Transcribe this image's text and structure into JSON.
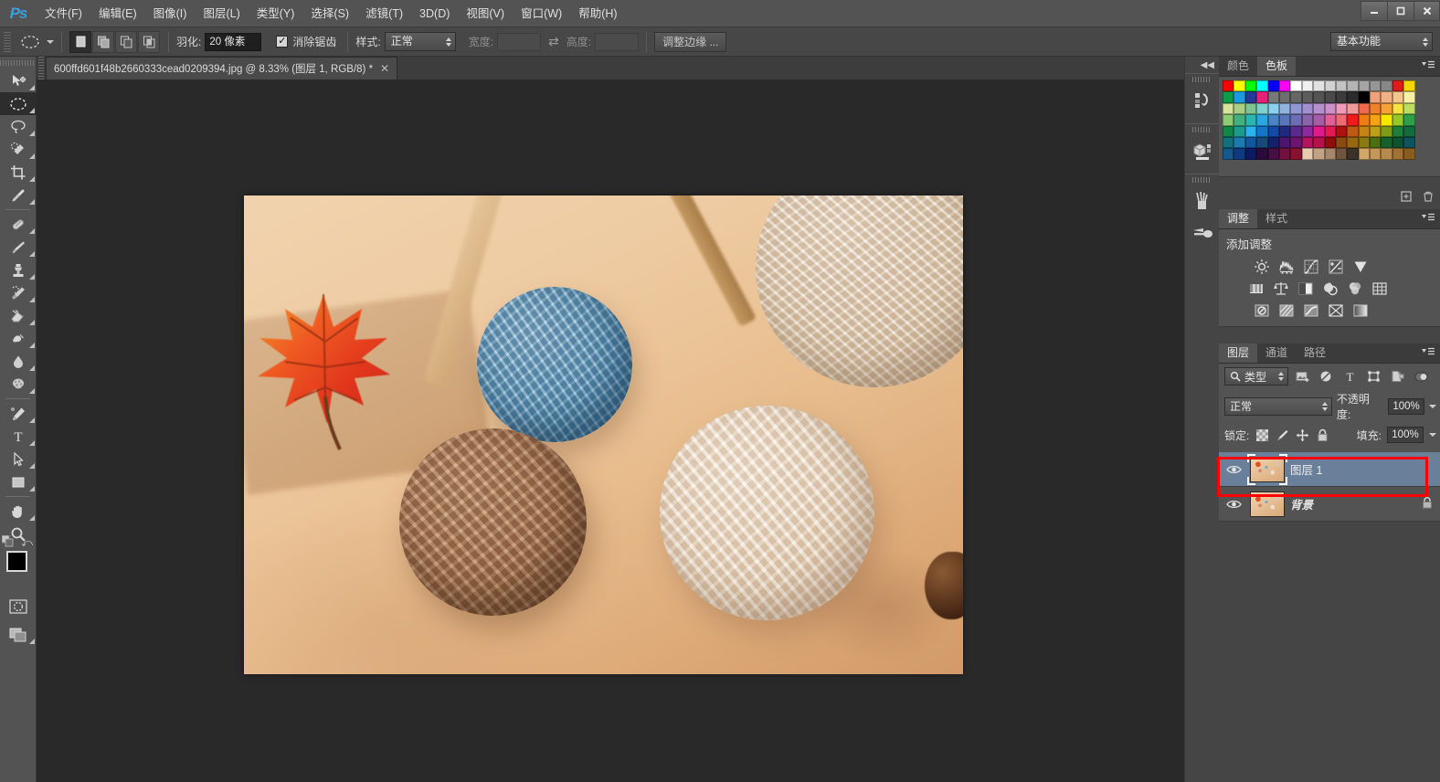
{
  "app": {
    "name": "Adobe Photoshop",
    "logo": "Ps"
  },
  "window_controls": {
    "minimize": "—",
    "restore": "❐",
    "close": "✕"
  },
  "menubar": {
    "items": [
      {
        "label": "文件(F)",
        "name": "menu-file"
      },
      {
        "label": "编辑(E)",
        "name": "menu-edit"
      },
      {
        "label": "图像(I)",
        "name": "menu-image"
      },
      {
        "label": "图层(L)",
        "name": "menu-layer"
      },
      {
        "label": "类型(Y)",
        "name": "menu-type"
      },
      {
        "label": "选择(S)",
        "name": "menu-select"
      },
      {
        "label": "滤镜(T)",
        "name": "menu-filter"
      },
      {
        "label": "3D(D)",
        "name": "menu-3d"
      },
      {
        "label": "视图(V)",
        "name": "menu-view"
      },
      {
        "label": "窗口(W)",
        "name": "menu-window"
      },
      {
        "label": "帮助(H)",
        "name": "menu-help"
      }
    ]
  },
  "options_bar": {
    "tool_preset_icon": "ellipse-marquee-icon",
    "selection_modes": [
      "new-selection",
      "add-to-selection",
      "subtract-from-selection",
      "intersect-selection"
    ],
    "feather_label": "羽化:",
    "feather_value": "20 像素",
    "antialias_label": "消除锯齿",
    "antialias_checked": true,
    "style_label": "样式:",
    "style_value": "正常",
    "width_label": "宽度:",
    "width_value": "",
    "height_label": "高度:",
    "height_value": "",
    "refine_edge_label": "调整边缘 ...",
    "workspace_value": "基本功能"
  },
  "toolbar": {
    "tools": [
      {
        "name": "move-tool",
        "icon": "move-icon",
        "active": false
      },
      {
        "name": "elliptical-marquee-tool",
        "icon": "ellipse-marquee-icon",
        "active": true
      },
      {
        "name": "lasso-tool",
        "icon": "lasso-icon",
        "active": false
      },
      {
        "name": "quick-selection-tool",
        "icon": "quick-select-icon",
        "active": false
      },
      {
        "name": "crop-tool",
        "icon": "crop-icon",
        "active": false
      },
      {
        "name": "eyedropper-tool",
        "icon": "eyedropper-icon",
        "active": false
      },
      {
        "name": "healing-brush-tool",
        "icon": "healing-brush-icon",
        "active": false
      },
      {
        "name": "brush-tool",
        "icon": "brush-icon",
        "active": false
      },
      {
        "name": "clone-stamp-tool",
        "icon": "clone-stamp-icon",
        "active": false
      },
      {
        "name": "history-brush-tool",
        "icon": "history-brush-icon",
        "active": false
      },
      {
        "name": "eraser-tool",
        "icon": "eraser-icon",
        "active": false
      },
      {
        "name": "gradient-tool",
        "icon": "gradient-icon",
        "active": false
      },
      {
        "name": "blur-tool",
        "icon": "blur-drop-icon",
        "active": false
      },
      {
        "name": "dodge-tool",
        "icon": "sponge-icon",
        "active": false
      },
      {
        "name": "pen-tool",
        "icon": "pen-icon",
        "active": false
      },
      {
        "name": "type-tool",
        "icon": "text-t-icon",
        "active": false
      },
      {
        "name": "path-selection-tool",
        "icon": "path-arrow-icon",
        "active": false
      },
      {
        "name": "rectangle-tool",
        "icon": "rectangle-shape-icon",
        "active": false
      },
      {
        "name": "hand-tool",
        "icon": "hand-icon",
        "active": false
      },
      {
        "name": "zoom-tool",
        "icon": "magnifier-icon",
        "active": false
      }
    ],
    "foreground_color": "#000000",
    "background_color": "#ffffff",
    "quick_mask_icon": "quick-mask-icon",
    "screen_mode_icon": "screen-mode-icon"
  },
  "document": {
    "tab_title": "600ffd601f48b2660333cead0209394.jpg @ 8.33% (图层 1, RGB/8) *",
    "close_glyph": "✕",
    "zoom": "8.33%",
    "color_mode": "RGB/8",
    "active_layer": "图层 1",
    "modified": true
  },
  "icon_strip": {
    "collapse_glyph": "◀◀",
    "groups": [
      [
        {
          "name": "history-panel-icon",
          "label": "历史记录"
        }
      ],
      [
        {
          "name": "3d-panel-icon",
          "label": "3D"
        }
      ],
      [
        {
          "name": "brush-presets-icon",
          "label": "画笔"
        },
        {
          "name": "clone-source-icon",
          "label": "仿制源"
        }
      ]
    ]
  },
  "color_panel": {
    "tabs": [
      {
        "label": "颜色",
        "active": false
      },
      {
        "label": "色板",
        "active": true
      }
    ],
    "swatch_rows": [
      [
        "#ff0000",
        "#ffff00",
        "#00ff00",
        "#00ffff",
        "#0000ff",
        "#ff00ff",
        "#ffffff",
        "#f0f0f0",
        "#e1e1e1",
        "#d2d2d2",
        "#c3c3c3",
        "#b4b4b4",
        "#a5a5a5",
        "#969696",
        "#878787",
        "#e01b1b",
        "#f5d800"
      ],
      [
        "#0a9d4e",
        "#1b9ae0",
        "#22389a",
        "#e61f77",
        "#787878",
        "#6e6e6e",
        "#666666",
        "#5d5d5d",
        "#545454",
        "#4a4a4a",
        "#3c3c3c",
        "#2c2c2c",
        "#000000",
        "#eda27a",
        "#f0b183",
        "#f3c58f",
        "#f9f0a8"
      ],
      [
        "#d6e59a",
        "#a8cf84",
        "#7ec490",
        "#7fd0cf",
        "#8ad0ef",
        "#8fb4e0",
        "#9097d3",
        "#a28fcf",
        "#b68fcd",
        "#cb90c8",
        "#ef9ab7",
        "#f29a99",
        "#ef6a4c",
        "#f0822c",
        "#f5a23a",
        "#f7e23e",
        "#bedd63",
        "#8fcb72"
      ],
      [
        "#45b07f",
        "#2bb5b1",
        "#2ba6e0",
        "#4b84c4",
        "#5a76bb",
        "#6c6db4",
        "#8a63ad",
        "#a85ca5",
        "#e25f98",
        "#ef6a73",
        "#ef1a1a",
        "#f07d10",
        "#f5a313",
        "#f7e800",
        "#95c828",
        "#2f9e48",
        "#13864a",
        "#1b9b8b"
      ],
      [
        "#2bb3ef",
        "#1277c8",
        "#1549a8",
        "#222a80",
        "#5a2a8c",
        "#8e2a9b",
        "#e0198c",
        "#e51a52",
        "#b01010",
        "#c05a12",
        "#c88412",
        "#bda014",
        "#7c9b16",
        "#1d7f3a",
        "#136b3c",
        "#12707a",
        "#1b7ab0",
        "#1356a0"
      ],
      [
        "#17497a",
        "#14226e",
        "#4c1670",
        "#6d1370",
        "#b21460",
        "#b5124a",
        "#8f0d0d",
        "#8b4a10",
        "#96680f",
        "#8a7a12",
        "#4c6f11",
        "#14612c",
        "#0e5230",
        "#0e5360",
        "#15588a",
        "#0e3a80",
        "#0c1a60"
      ],
      [
        "#2a0a3a",
        "#470f46",
        "#74103f",
        "#8a1030",
        "#e6cdb0",
        "#c3a184",
        "#a8866a",
        "#6f5440",
        "#3b3227",
        "#d2a86a",
        "#c49858",
        "#b58a4a",
        "#a07236",
        "#8a5c1e"
      ]
    ]
  },
  "adjustments_panel": {
    "tabs": [
      {
        "label": "调整",
        "active": true
      },
      {
        "label": "样式",
        "active": false
      }
    ],
    "title": "添加调整",
    "rows": [
      [
        "brightness-contrast-icon",
        "levels-icon",
        "curves-icon",
        "exposure-icon",
        "vibrance-icon"
      ],
      [
        "hue-saturation-icon",
        "color-balance-icon",
        "black-white-icon",
        "photo-filter-icon",
        "channel-mixer-icon",
        "color-lookup-icon"
      ],
      [
        "invert-icon",
        "posterize-icon",
        "threshold-icon",
        "selective-color-icon",
        "gradient-map-icon"
      ]
    ]
  },
  "layers_panel": {
    "tabs": [
      {
        "label": "图层",
        "active": true
      },
      {
        "label": "通道",
        "active": false
      },
      {
        "label": "路径",
        "active": false
      }
    ],
    "filter": {
      "kind_label": "类型",
      "search_icon": "search-icon",
      "filter_icons": [
        "filter-image-icon",
        "filter-adjustment-icon",
        "filter-type-icon",
        "filter-shape-icon",
        "filter-smartobject-icon"
      ],
      "toggle_icon": "filter-toggle-icon"
    },
    "blend_mode": "正常",
    "opacity_label": "不透明度:",
    "opacity_value": "100%",
    "lock_label": "锁定:",
    "lock_icons": [
      "lock-transparency-icon",
      "lock-image-icon",
      "lock-position-icon",
      "lock-all-icon"
    ],
    "fill_label": "填充:",
    "fill_value": "100%",
    "layers": [
      {
        "name": "图层 1",
        "visible": true,
        "selected": true,
        "locked": false,
        "is_background": false
      },
      {
        "name": "背景",
        "visible": true,
        "selected": false,
        "locked": true,
        "is_background": true
      }
    ],
    "annotation": {
      "type": "highlight-box",
      "color": "#ff0000",
      "target": "图层 1"
    }
  }
}
